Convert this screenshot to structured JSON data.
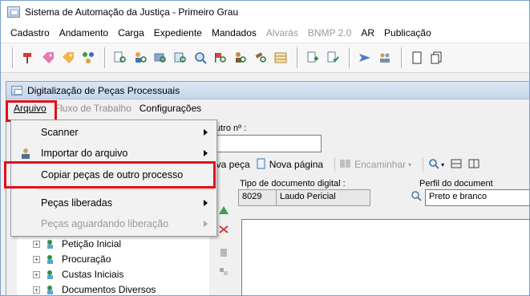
{
  "window": {
    "title": "Sistema de Automação da Justiça - Primeiro Grau"
  },
  "menubar": {
    "items": [
      {
        "label": "Cadastro",
        "disabled": false
      },
      {
        "label": "Andamento",
        "disabled": false
      },
      {
        "label": "Carga",
        "disabled": false
      },
      {
        "label": "Expediente",
        "disabled": false
      },
      {
        "label": "Mandados",
        "disabled": false
      },
      {
        "label": "Alvarás",
        "disabled": true
      },
      {
        "label": "BNMP 2.0",
        "disabled": true
      },
      {
        "label": "AR",
        "disabled": false
      },
      {
        "label": "Publicação",
        "disabled": false
      }
    ]
  },
  "child_window": {
    "title": "Digitalização de Peças Processuais",
    "menu": {
      "arquivo": "Arquivo",
      "fluxo": "Fluxo de Trabalho",
      "configuracoes": "Configurações"
    }
  },
  "dropdown": {
    "items": [
      {
        "label": "Scanner",
        "submenu": true,
        "disabled": false
      },
      {
        "label": "Importar do arquivo",
        "submenu": true,
        "disabled": false
      },
      {
        "label": "Copiar peças de outro processo",
        "submenu": false,
        "disabled": false
      },
      {
        "label": "Peças liberadas",
        "submenu": true,
        "disabled": false
      },
      {
        "label": "Peças aguardando liberação",
        "submenu": true,
        "disabled": true
      }
    ]
  },
  "form": {
    "outro_label": "utro nº :",
    "tipo_label": "Tipo de documento digital :",
    "tipo_code": "8029",
    "tipo_value": "Laudo Pericial",
    "perfil_label": "Perfil do document",
    "perfil_value": "Preto e branco"
  },
  "actions": {
    "nova_peca": "ova peça",
    "nova_pagina": "Nova página",
    "encaminhar": "Encaminhar"
  },
  "tree": {
    "items": [
      {
        "label": "Petição Inicial"
      },
      {
        "label": "Procuração"
      },
      {
        "label": "Custas Iniciais"
      },
      {
        "label": "Documentos Diversos"
      }
    ]
  },
  "colors": {
    "highlight_border": "#e0101a",
    "window_border": "#7aa0cc"
  }
}
